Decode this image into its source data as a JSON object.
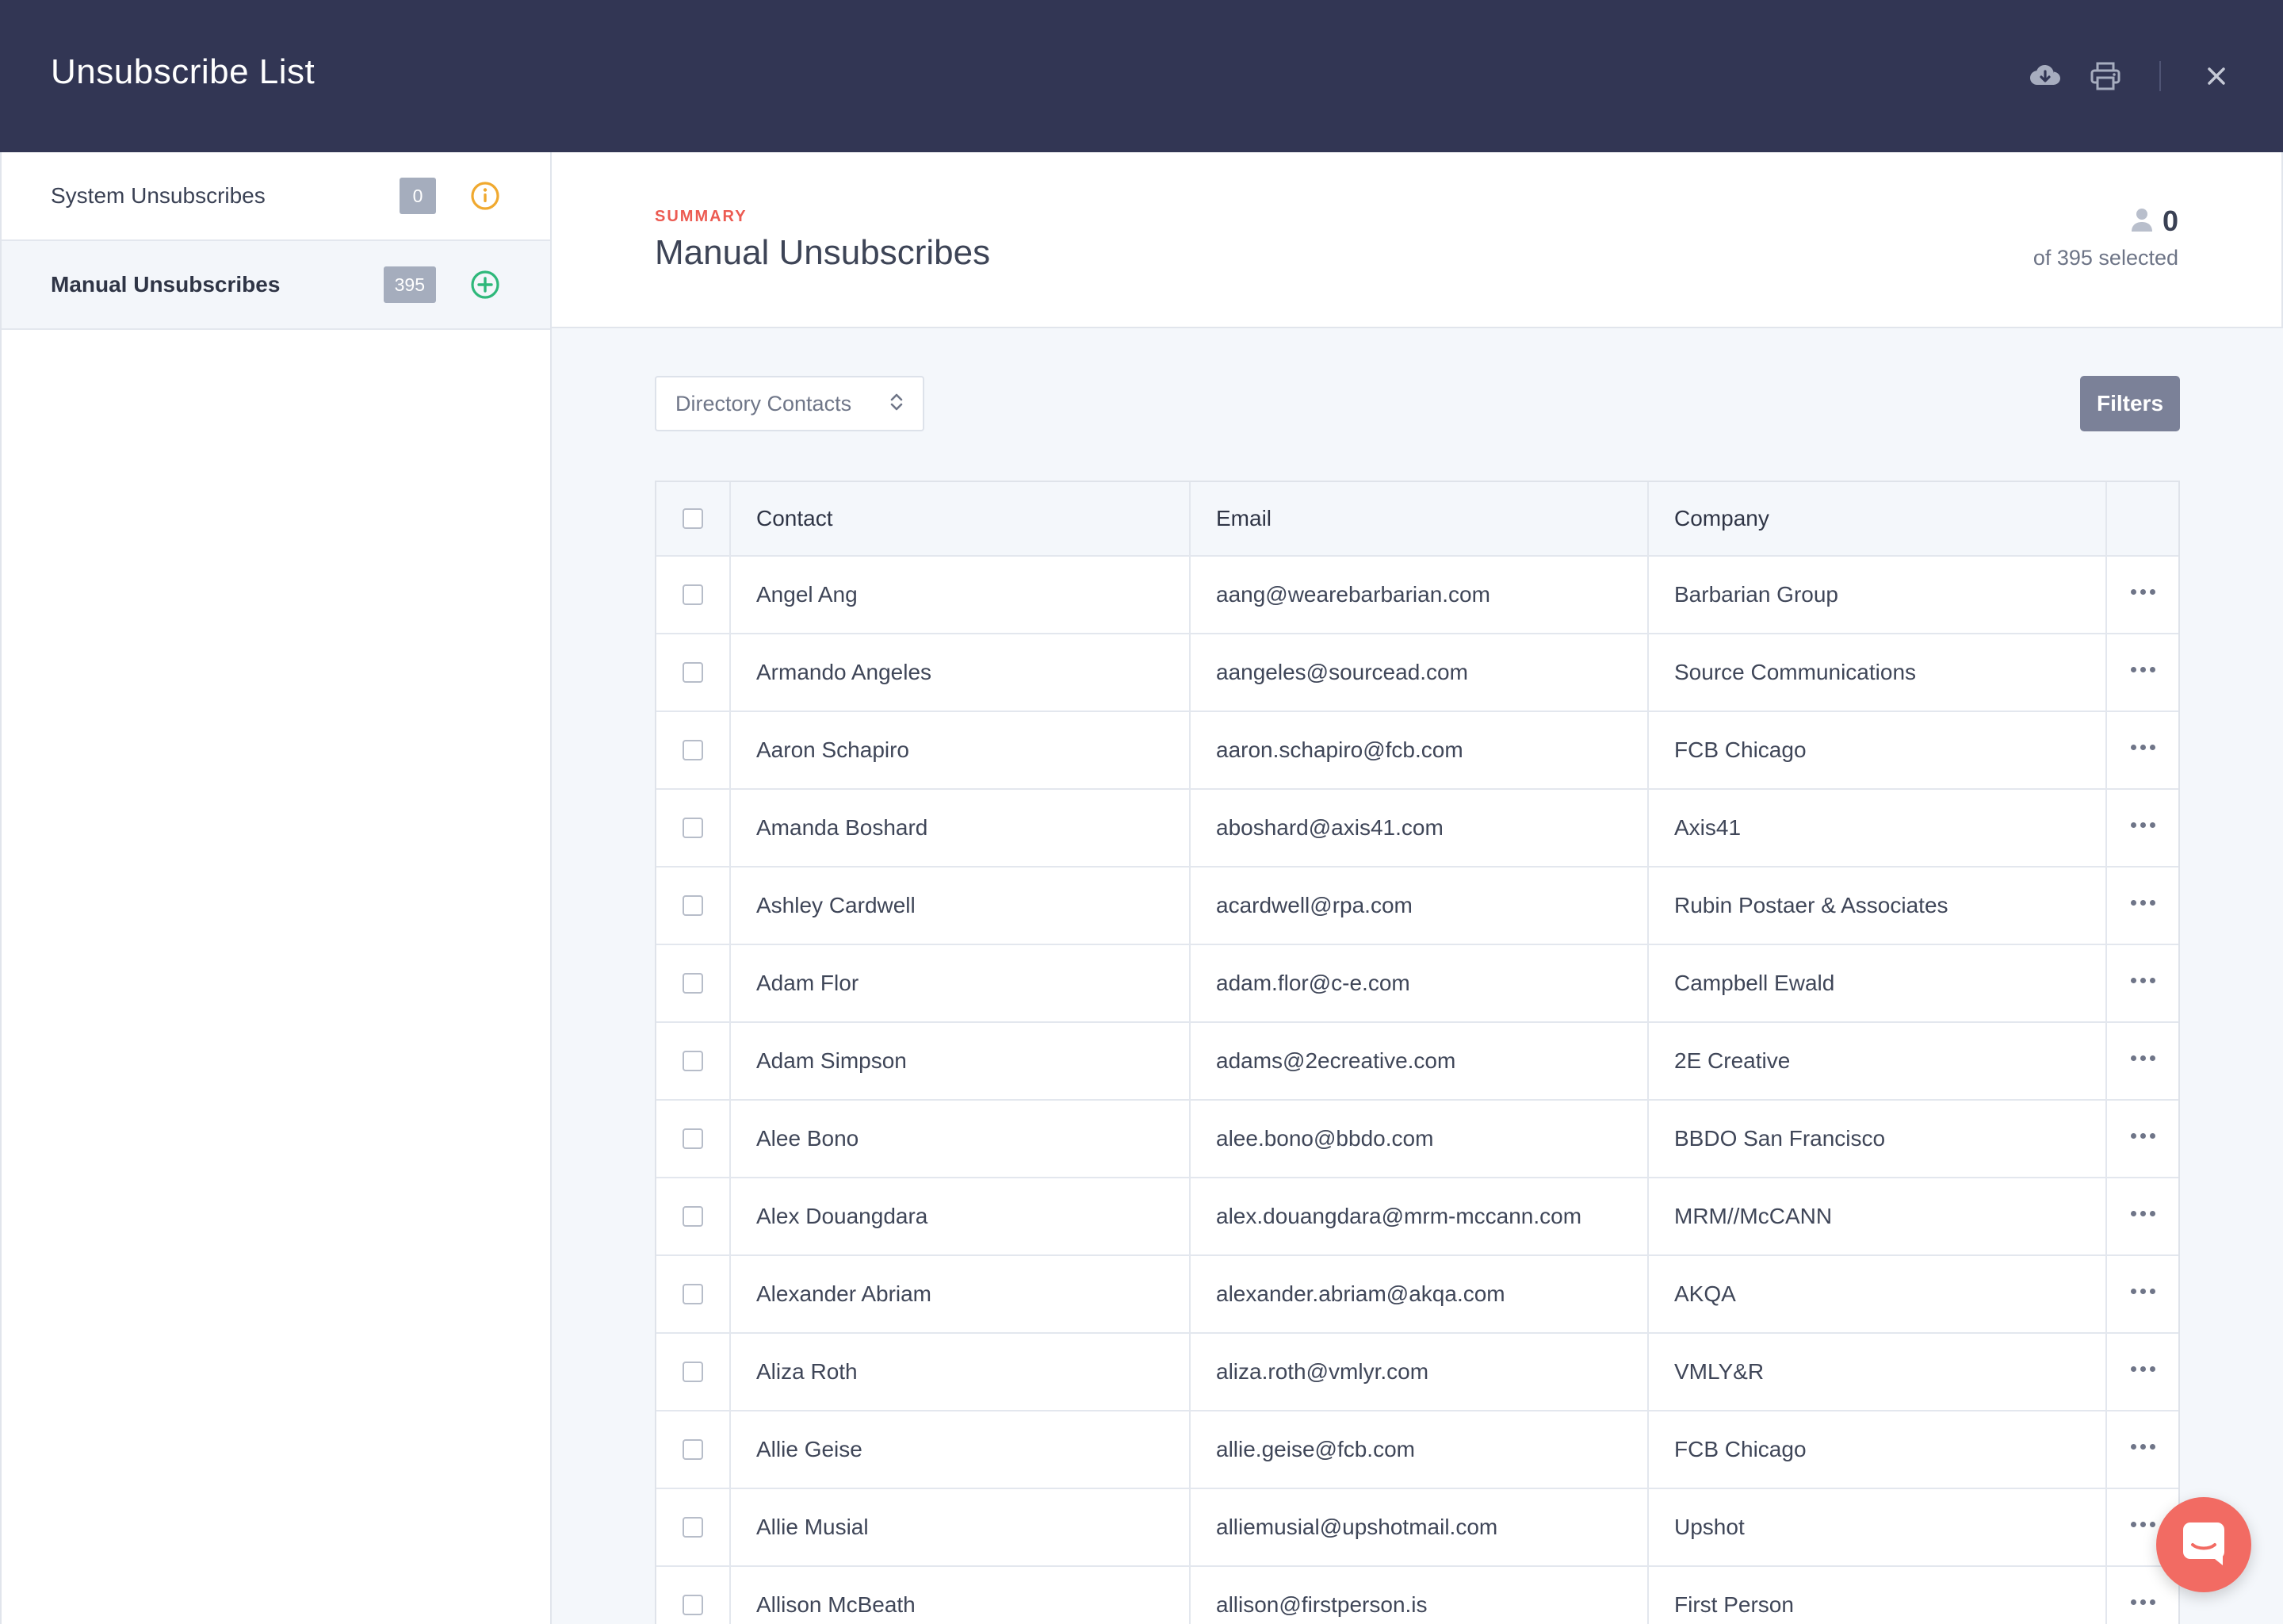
{
  "header": {
    "title": "Unsubscribe List",
    "icons": [
      "cloud-download-icon",
      "printer-icon",
      "close-icon"
    ]
  },
  "sidebar": {
    "items": [
      {
        "label": "System Unsubscribes",
        "count": "0",
        "icon": "info-icon",
        "icon_color": "#f0a92f"
      },
      {
        "label": "Manual Unsubscribes",
        "count": "395",
        "icon": "add-circle-icon",
        "icon_color": "#2eb87a"
      }
    ]
  },
  "summary": {
    "eyebrow": "SUMMARY",
    "title": "Manual Unsubscribes",
    "selected_count": "0",
    "selected_sub": "of 395 selected"
  },
  "toolbar": {
    "dropdown_value": "Directory Contacts",
    "filters_label": "Filters"
  },
  "table": {
    "headers": {
      "contact": "Contact",
      "email": "Email",
      "company": "Company"
    },
    "rows": [
      {
        "contact": "Angel Ang",
        "email": "aang@wearebarbarian.com",
        "company": "Barbarian Group"
      },
      {
        "contact": "Armando Angeles",
        "email": "aangeles@sourcead.com",
        "company": "Source Communications"
      },
      {
        "contact": "Aaron Schapiro",
        "email": "aaron.schapiro@fcb.com",
        "company": "FCB Chicago"
      },
      {
        "contact": "Amanda Boshard",
        "email": "aboshard@axis41.com",
        "company": "Axis41"
      },
      {
        "contact": "Ashley Cardwell",
        "email": "acardwell@rpa.com",
        "company": "Rubin Postaer & Associates"
      },
      {
        "contact": "Adam Flor",
        "email": "adam.flor@c-e.com",
        "company": "Campbell Ewald"
      },
      {
        "contact": "Adam Simpson",
        "email": "adams@2ecreative.com",
        "company": "2E Creative"
      },
      {
        "contact": "Alee Bono",
        "email": "alee.bono@bbdo.com",
        "company": "BBDO San Francisco"
      },
      {
        "contact": "Alex Douangdara",
        "email": "alex.douangdara@mrm-mccann.com",
        "company": "MRM//McCANN"
      },
      {
        "contact": "Alexander Abriam",
        "email": "alexander.abriam@akqa.com",
        "company": "AKQA"
      },
      {
        "contact": "Aliza Roth",
        "email": "aliza.roth@vmlyr.com",
        "company": "VMLY&R"
      },
      {
        "contact": "Allie Geise",
        "email": "allie.geise@fcb.com",
        "company": "FCB Chicago"
      },
      {
        "contact": "Allie Musial",
        "email": "alliemusial@upshotmail.com",
        "company": "Upshot"
      },
      {
        "contact": "Allison McBeath",
        "email": "allison@firstperson.is",
        "company": "First Person"
      }
    ]
  },
  "colors": {
    "header_bg": "#323654",
    "accent_red": "#ec5b52",
    "filters_bg": "#7b8198",
    "chat_bg": "#f26b63"
  }
}
